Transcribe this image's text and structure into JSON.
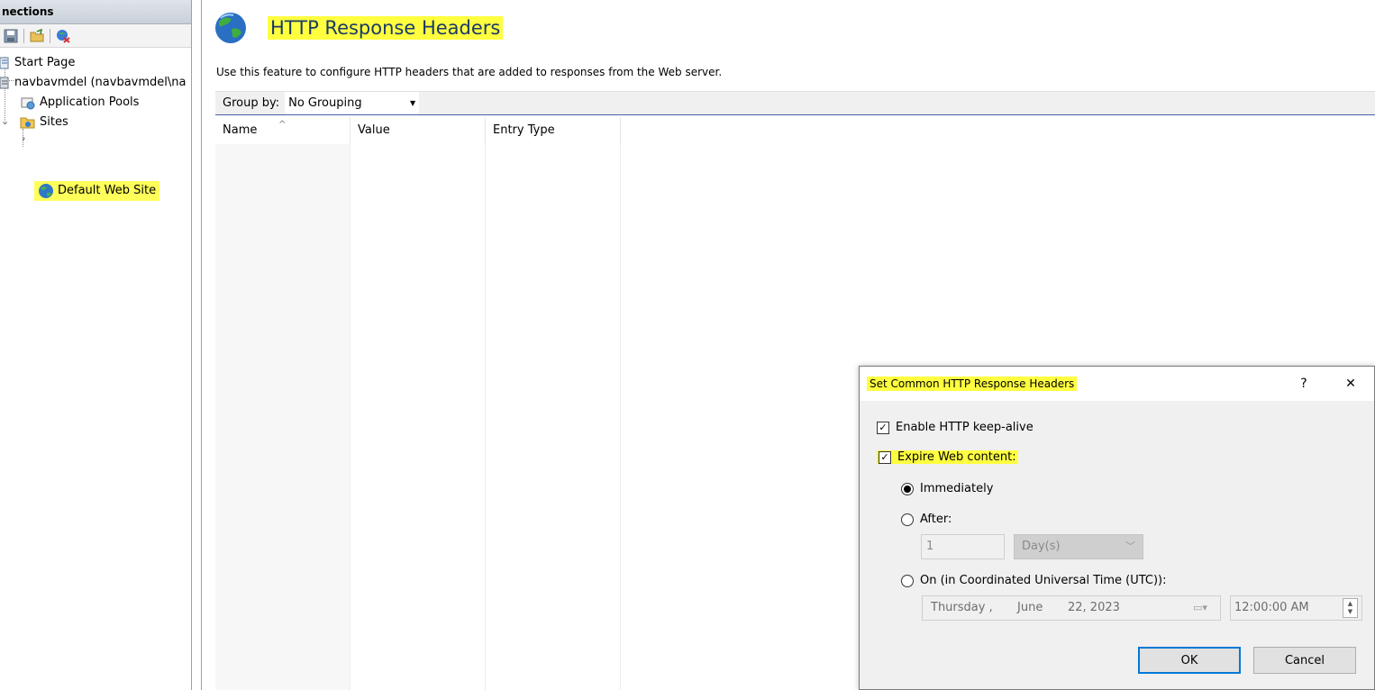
{
  "left_pane": {
    "header": "nections",
    "tree": {
      "start_page": "Start Page",
      "server": "navbavmdel (navbavmdel\\na",
      "app_pools": "Application Pools",
      "sites": "Sites",
      "default_site": "Default Web Site"
    }
  },
  "main": {
    "title": "HTTP Response Headers",
    "description": "Use this feature to configure HTTP headers that are added to responses from the Web server.",
    "group_by_label": "Group by:",
    "group_by_value": "No Grouping",
    "columns": [
      "Name",
      "Value",
      "Entry Type"
    ]
  },
  "dialog": {
    "title": "Set Common HTTP Response Headers",
    "help": "?",
    "close": "✕",
    "keep_alive_label": "Enable HTTP keep-alive",
    "expire_label": "Expire Web content:",
    "immediately_label": "Immediately",
    "after_label": "After:",
    "after_value": "1",
    "after_unit": "Day(s)",
    "on_label": "On (in Coordinated Universal Time (UTC)):",
    "date": {
      "weekday": "Thursday ,",
      "month": "June",
      "day_year": "22, 2023"
    },
    "time": "12:00:00 AM",
    "ok": "OK",
    "cancel": "Cancel"
  },
  "colors": {
    "highlight": "#ffff40",
    "accent": "#0078d7",
    "title_blue": "#1a3a66"
  }
}
